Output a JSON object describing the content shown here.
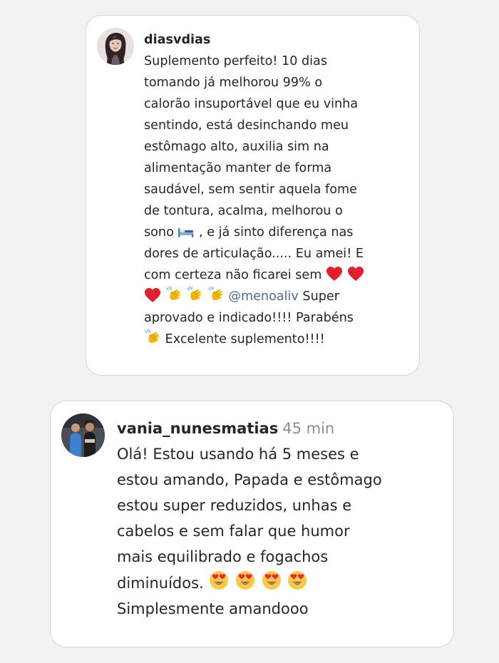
{
  "comments": [
    {
      "username": "diasvdias",
      "time": "",
      "lines": {
        "l1": "Suplemento perfeito! 10 dias",
        "l2": "tomando já melhorou 99% o",
        "l3": "calorão insuportável que eu vinha",
        "l4": "sentindo, está desinchando meu",
        "l5": "estômago alto, auxilia sim na",
        "l6": "alimentação manter de forma",
        "l7": "saudável, sem sentir aquela fome",
        "l8": "de tontura, acalma, melhorou o",
        "l9a": "sono",
        "l9b": ", e já sinto diferença nas",
        "l10": "dores de articulação..... Eu amei! E",
        "l11": "com certeza não ficarei sem",
        "l12_mention": "@menoaliv",
        "l12_text": "Super",
        "l13": "aprovado e indicado!!!! Parabéns",
        "l14": "Excelente suplemento!!!!"
      },
      "emoji": {
        "bed": "bed-emoji",
        "heart": "red-heart-emoji",
        "clap": "clapping-hands-emoji"
      }
    },
    {
      "username": "vania_nunesmatias",
      "time": "45 min",
      "lines": {
        "l1": "Olá! Estou usando há 5 meses e",
        "l2": "estou amando, Papada e estômago",
        "l3": "estou super reduzidos, unhas e",
        "l4": "cabelos e sem falar que humor",
        "l5": "mais equilibrado e fogachos",
        "l6": "diminuídos.",
        "l7": "Simplesmente amandooo"
      },
      "emoji": {
        "hearteyes": "smiling-face-with-heart-eyes-emoji"
      }
    }
  ],
  "colors": {
    "background": "#f2f2f2",
    "card": "#ffffff",
    "text": "#262626",
    "muted": "#8e8e8e",
    "mention": "#4f6a8f",
    "heart": "#e0202e",
    "clap": "#f4b400"
  }
}
